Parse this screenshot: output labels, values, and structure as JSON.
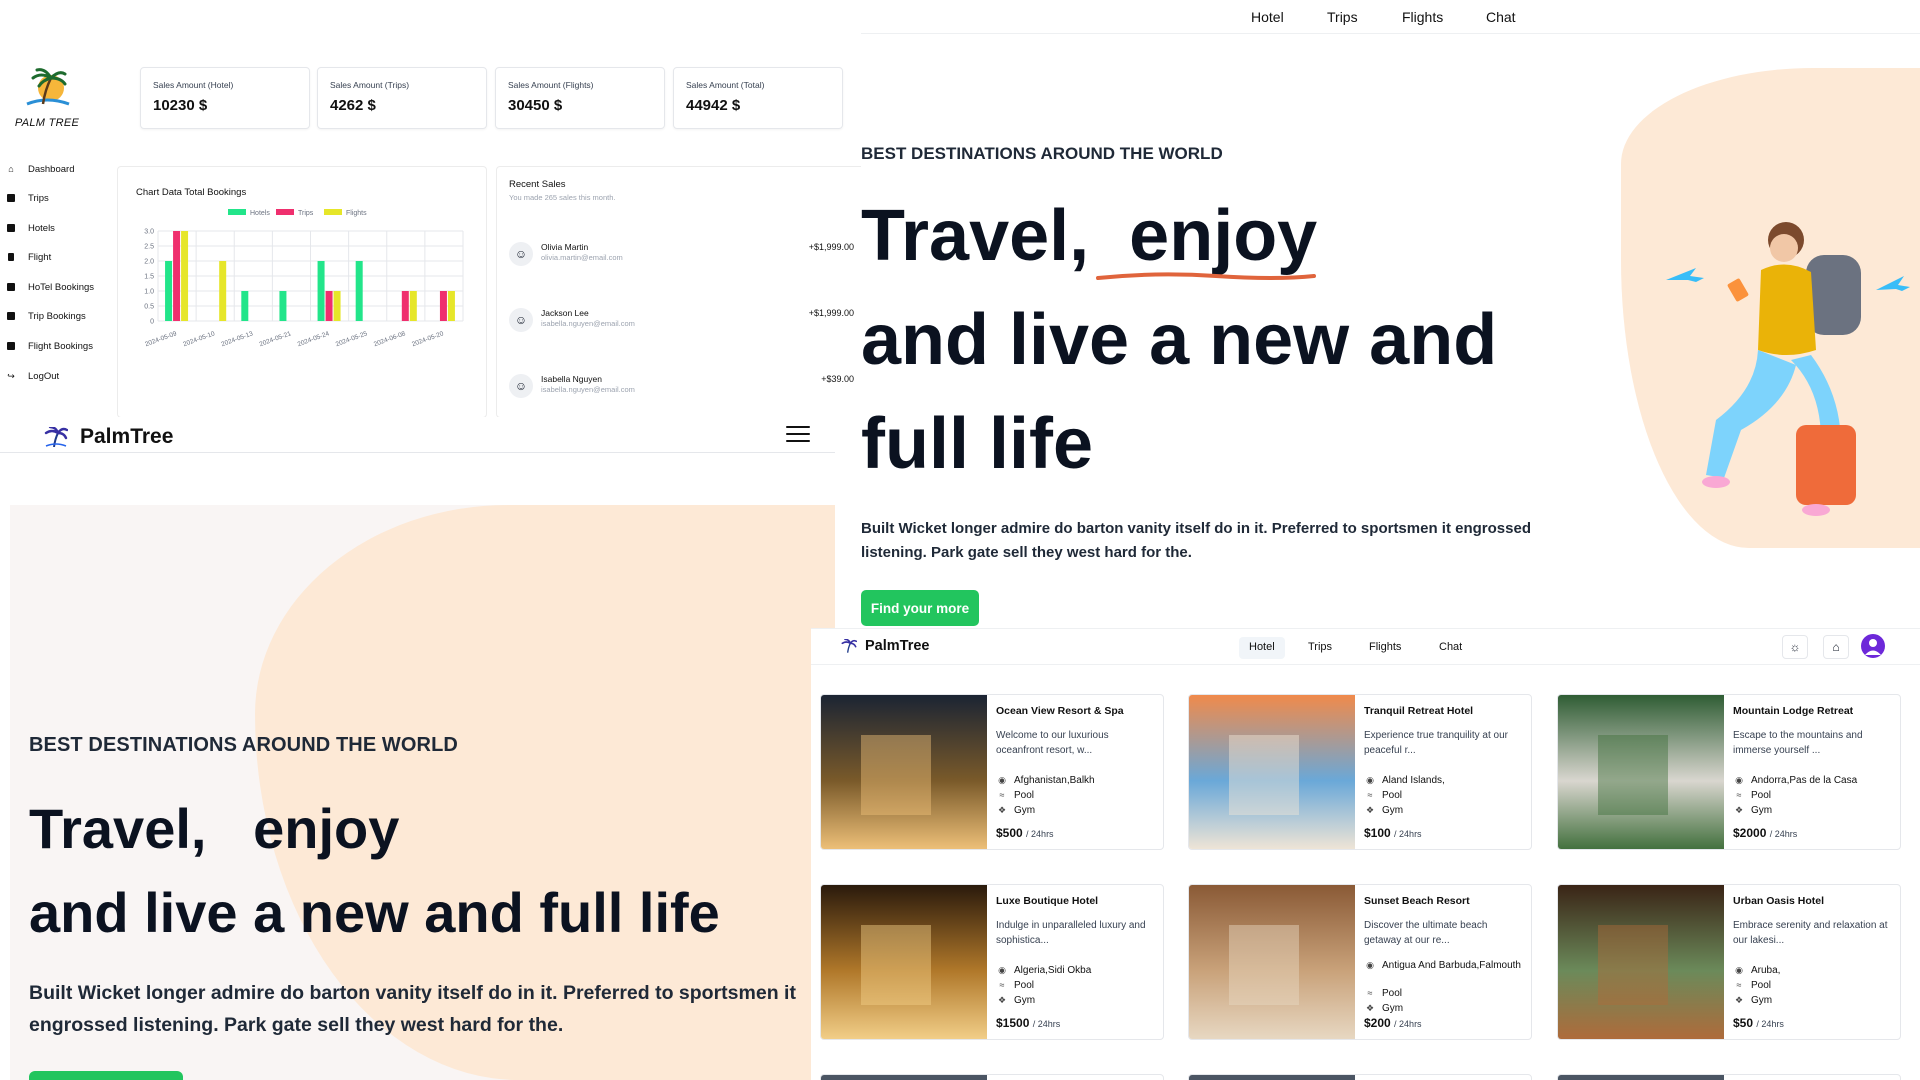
{
  "admin": {
    "logo_text": "PALM TREE",
    "stats": [
      {
        "label": "Sales Amount (Hotel)",
        "value": "10230 $"
      },
      {
        "label": "Sales Amount (Trips)",
        "value": "4262 $"
      },
      {
        "label": "Sales Amount (Flights)",
        "value": "30450 $"
      },
      {
        "label": "Sales Amount (Total)",
        "value": "44942 $"
      }
    ],
    "sidebar": [
      {
        "label": "Dashboard",
        "icon": "home-icon"
      },
      {
        "label": "Trips",
        "icon": "grid-icon"
      },
      {
        "label": "Hotels",
        "icon": "hotel-icon"
      },
      {
        "label": "Flight",
        "icon": "flight-icon"
      },
      {
        "label": "HoTel Bookings",
        "icon": "booking-icon"
      },
      {
        "label": "Trip Bookings",
        "icon": "booking-icon"
      },
      {
        "label": "Flight Bookings",
        "icon": "booking-icon"
      },
      {
        "label": "LogOut",
        "icon": "logout-icon"
      }
    ],
    "chart_title": "Chart Data Total Bookings",
    "recent_sales": {
      "title": "Recent Sales",
      "subtitle": "You made 265 sales this month.",
      "items": [
        {
          "name": "Olivia Martin",
          "email": "olivia.martin@email.com",
          "amount": "+$1,999.00"
        },
        {
          "name": "Jackson Lee",
          "email": "isabella.nguyen@email.com",
          "amount": "+$1,999.00"
        },
        {
          "name": "Isabella Nguyen",
          "email": "isabella.nguyen@email.com",
          "amount": "+$39.00"
        }
      ]
    }
  },
  "chart_data": {
    "type": "bar",
    "title": "Chart Data Total Bookings",
    "categories": [
      "2024-05-09",
      "2024-05-10",
      "2024-05-13",
      "2024-05-21",
      "2024-05-24",
      "2024-05-25",
      "2024-06-08",
      "2024-05-20"
    ],
    "series": [
      {
        "name": "Hotels",
        "color": "#22e58a",
        "values": [
          2,
          0,
          1,
          1,
          2,
          2,
          0,
          0
        ]
      },
      {
        "name": "Trips",
        "color": "#ef2f6e",
        "values": [
          3,
          0,
          0,
          0,
          1,
          0,
          1,
          1
        ]
      },
      {
        "name": "Flights",
        "color": "#e6e629",
        "values": [
          3,
          2,
          0,
          0,
          1,
          0,
          1,
          1
        ]
      }
    ],
    "yticks": [
      "3.0",
      "2.5",
      "2.0",
      "1.5",
      "1.0",
      "0.5",
      "0"
    ],
    "ylim": [
      0,
      3
    ],
    "legend_position": "top",
    "grid": true
  },
  "mobile": {
    "brand": "PalmTree",
    "kicker": "BEST DESTINATIONS AROUND THE WORLD",
    "headline_1": "Travel,   enjoy",
    "headline_2": "and live a new and full life",
    "paragraph": "Built Wicket longer admire do barton vanity itself do in it. Preferred to sportsmen it engrossed listening. Park gate sell they west hard for the."
  },
  "desktop": {
    "nav": [
      "Hotel",
      "Trips",
      "Flights",
      "Chat"
    ],
    "kicker": "BEST DESTINATIONS AROUND THE WORLD",
    "headline_1": "Travel,  enjoy",
    "headline_2": "and live a new and",
    "headline_3": "full life",
    "paragraph": "Built Wicket longer admire do barton vanity itself do in it. Preferred to sportsmen it engrossed listening. Park gate sell they west hard for the.",
    "cta": "Find your more",
    "accent": "#22c55e"
  },
  "hotels_page": {
    "brand": "PalmTree",
    "tabs": [
      "Hotel",
      "Trips",
      "Flights",
      "Chat"
    ],
    "active_tab": "Hotel",
    "per_label": "/ 24hrs",
    "hotels": [
      {
        "name": "Ocean View Resort & Spa",
        "desc": "Welcome to our luxurious oceanfront resort, w...",
        "location": "Afghanistan,Balkh",
        "features": [
          "Pool",
          "Gym"
        ],
        "price": "$500"
      },
      {
        "name": "Tranquil Retreat Hotel",
        "desc": "Experience true tranquility at our peaceful r...",
        "location": "Aland Islands,",
        "features": [
          "Pool",
          "Gym"
        ],
        "price": "$100"
      },
      {
        "name": "Mountain Lodge Retreat",
        "desc": "Escape to the mountains and immerse yourself ...",
        "location": "Andorra,Pas de la Casa",
        "features": [
          "Pool",
          "Gym"
        ],
        "price": "$2000"
      },
      {
        "name": "Luxe Boutique Hotel",
        "desc": "Indulge in unparalleled luxury and sophistica...",
        "location": "Algeria,Sidi Okba",
        "features": [
          "Pool",
          "Gym"
        ],
        "price": "$1500"
      },
      {
        "name": "Sunset Beach Resort",
        "desc": "Discover the ultimate beach getaway at our re...",
        "location": "Antigua And Barbuda,Falmouth",
        "features": [
          "Pool",
          "Gym"
        ],
        "price": "$200"
      },
      {
        "name": "Urban Oasis Hotel",
        "desc": "Embrace serenity and relaxation at our lakesi...",
        "location": "Aruba,",
        "features": [
          "Pool",
          "Gym"
        ],
        "price": "$50"
      }
    ]
  }
}
